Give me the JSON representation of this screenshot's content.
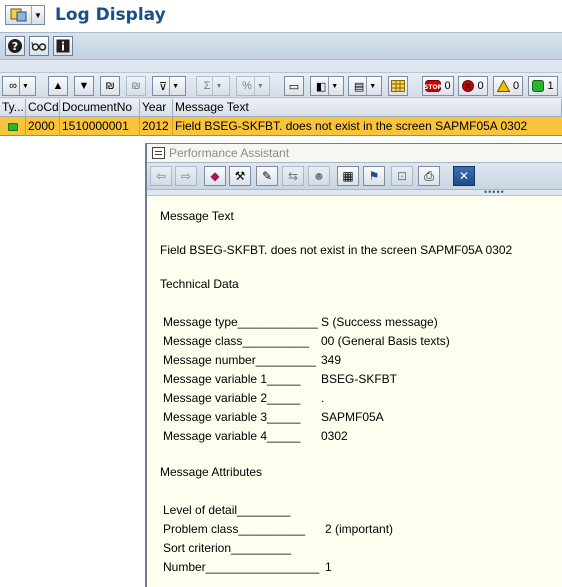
{
  "window": {
    "title": "Log Display"
  },
  "app_toolbar": {
    "buttons": [
      {
        "name": "help-icon",
        "glyph": "?"
      },
      {
        "name": "glasses-icon",
        "glyph": "∞"
      },
      {
        "name": "info-icon",
        "glyph": "i"
      }
    ]
  },
  "alv_toolbar": {
    "status_counts": {
      "stop": "0",
      "error": "0",
      "warning": "0",
      "success": "1"
    }
  },
  "grid": {
    "columns": [
      "Ty...",
      "CoCd",
      "DocumentNo",
      "Year",
      "Message Text"
    ],
    "rows": [
      {
        "type_color": "#29b32f",
        "cocd": "2000",
        "document_no": "1510000001",
        "year": "2012",
        "message_text": "Field BSEG-SKFBT. does not exist in the screen SAPMF05A 0302"
      }
    ]
  },
  "performance_assistant": {
    "title": "Performance Assistant",
    "section_message_text": "Message Text",
    "message": "Field BSEG-SKFBT. does not exist in the screen SAPMF05A 0302",
    "section_technical_data": "Technical Data",
    "technical_data": [
      {
        "label": "Message type____________",
        "value": "S (Success message)"
      },
      {
        "label": "Message class__________",
        "value": "00 (General Basis texts)"
      },
      {
        "label": "Message number_________",
        "value": "349"
      },
      {
        "label": "Message variable 1_____",
        "value": "BSEG-SKFBT"
      },
      {
        "label": "Message variable 2_____",
        "value": "."
      },
      {
        "label": "Message variable 3_____",
        "value": "SAPMF05A"
      },
      {
        "label": "Message variable 4_____",
        "value": "0302"
      }
    ],
    "section_message_attributes": "Message Attributes",
    "message_attributes": [
      {
        "label": "Level of detail________",
        "value": ""
      },
      {
        "label": "Problem class__________",
        "value": "2 (important)"
      },
      {
        "label": "Sort criterion_________",
        "value": ""
      },
      {
        "label": "Number_________________",
        "value": "1"
      }
    ]
  },
  "colors": {
    "title_blue": "#1b4f8a",
    "row_highlight": "#f9c33a",
    "popup_background": "#fffff0",
    "success_green": "#29b32f",
    "error_red": "#d40000",
    "warning_yellow": "#f2c200"
  }
}
